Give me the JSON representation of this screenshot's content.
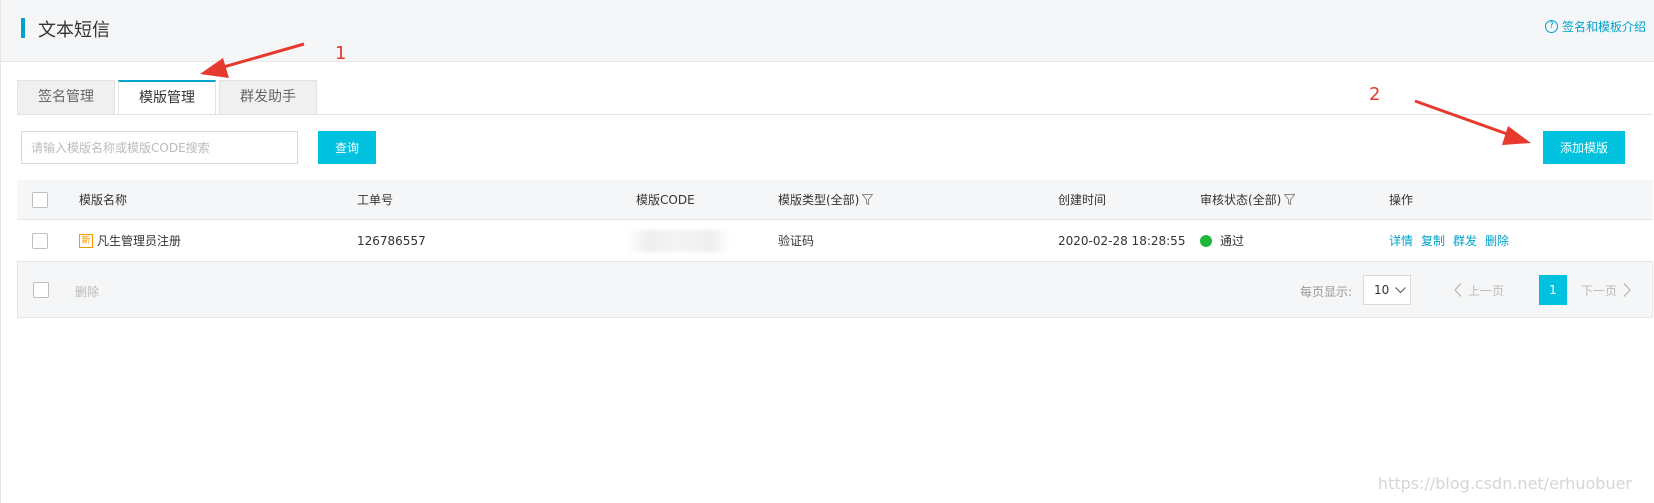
{
  "header": {
    "title": "文本短信",
    "help_link": "签名和模板介绍"
  },
  "tabs": [
    {
      "label": "签名管理",
      "active": false
    },
    {
      "label": "模版管理",
      "active": true
    },
    {
      "label": "群发助手",
      "active": false
    }
  ],
  "search": {
    "placeholder": "请输入模版名称或模版CODE搜索",
    "value": "",
    "query_label": "查询"
  },
  "add_template_label": "添加模版",
  "table": {
    "columns": [
      "模版名称",
      "工单号",
      "模版CODE",
      "模版类型(全部)",
      "创建时间",
      "审核状态(全部)",
      "操作"
    ],
    "rows": [
      {
        "name": "凡生管理员注册",
        "badge": "新",
        "ticket": "126786557",
        "code": "",
        "type": "验证码",
        "created": "2020-02-28 18:28:55",
        "status": "通过",
        "actions": [
          "详情",
          "复制",
          "群发",
          "删除"
        ]
      }
    ]
  },
  "footer": {
    "delete_label": "删除",
    "page_size_label": "每页显示:",
    "page_size": "10",
    "prev_label": "上一页",
    "current_page": "1",
    "next_label": "下一页"
  },
  "annotations": [
    "1",
    "2"
  ],
  "watermark": "https://blog.csdn.net/erhuobuer",
  "colors": {
    "accent": "#00c1de",
    "link": "#00a2ca",
    "status_ok": "#1fb83a",
    "annotation": "#e63a2e"
  }
}
